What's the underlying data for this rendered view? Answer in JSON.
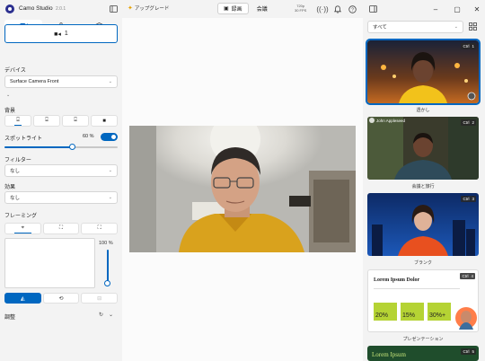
{
  "app": {
    "title": "Camo Studio",
    "version": "2.0.1"
  },
  "titlebar": {
    "upgrade_label": "アップグレード",
    "modes": [
      {
        "label": "録画"
      },
      {
        "label": "会議"
      }
    ],
    "format_line1": "720p",
    "format_line2": "30 FPS"
  },
  "left": {
    "camera_count": "1",
    "device_label": "デバイス",
    "device_value": "Surface Camera Front",
    "background_label": "背景",
    "spotlight_label": "スポットライト",
    "spotlight_value": "60 %",
    "spotlight_level": 0.6,
    "filter_label": "フィルター",
    "filter_value": "なし",
    "effect_label": "効果",
    "effect_value": "なし",
    "framing_label": "フレーミング",
    "zoom_value": "100 %",
    "adjust_label": "調整"
  },
  "right": {
    "scene_filter": "すべて",
    "scenes": [
      {
        "label": "透かし",
        "shortcut": "Ctrl",
        "num": "1"
      },
      {
        "label": "会議と旅行",
        "shortcut": "Ctrl",
        "num": "2",
        "name_text": "John Appleseed"
      },
      {
        "label": "ブランク",
        "shortcut": "Ctrl",
        "num": "3"
      },
      {
        "label": "プレゼンテーション",
        "shortcut": "Ctrl",
        "num": "4",
        "title_text": "Lorem Ipsum Dolor",
        "stats": [
          "20%",
          "15%",
          "30%+"
        ]
      },
      {
        "label": "",
        "shortcut": "Ctrl",
        "num": "5",
        "title_text": "Lorem Ipsum"
      }
    ]
  },
  "colors": {
    "accent": "#0067c0",
    "green": "#b5d334"
  }
}
